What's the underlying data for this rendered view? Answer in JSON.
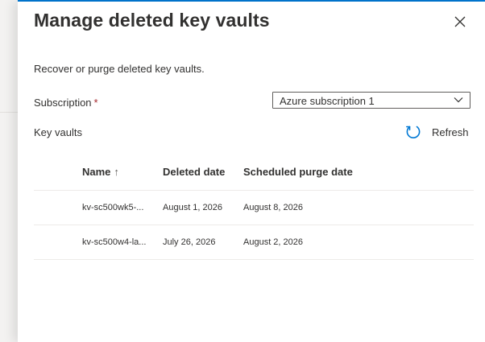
{
  "dialog": {
    "title": "Manage deleted key vaults",
    "description": "Recover or purge deleted key vaults."
  },
  "subscription": {
    "label": "Subscription",
    "required_marker": "*",
    "selected": "Azure subscription 1"
  },
  "key_vaults": {
    "label": "Key vaults",
    "refresh_label": "Refresh"
  },
  "table": {
    "columns": {
      "name": "Name",
      "name_sort": "↑",
      "deleted_date": "Deleted date",
      "purge_date": "Scheduled purge date"
    },
    "rows": [
      {
        "name": "kv-sc500wk5-...",
        "deleted_date": "August 1, 2026",
        "purge_date": "August 8, 2026"
      },
      {
        "name": "kv-sc500w4-la...",
        "deleted_date": "July 26, 2026",
        "purge_date": "August 2, 2026"
      }
    ]
  },
  "colors": {
    "accent": "#0078d4",
    "required": "#a4262c",
    "text": "#323130"
  },
  "icons": {
    "close": "close-icon",
    "dropdown": "chevron-down-icon",
    "refresh": "refresh-icon"
  }
}
